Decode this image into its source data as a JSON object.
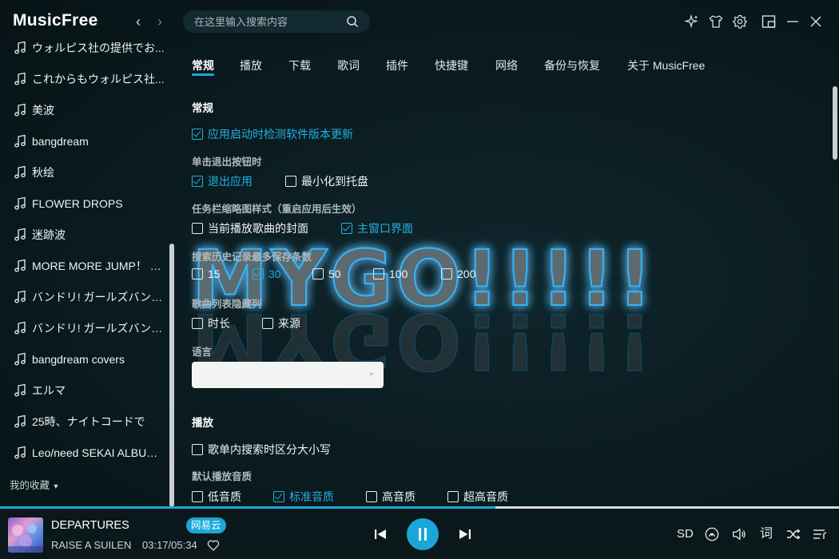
{
  "app": {
    "title": "MusicFree"
  },
  "nav": {
    "back": "‹",
    "forward": "›"
  },
  "search": {
    "placeholder": "在这里输入搜索内容"
  },
  "sidebar": {
    "items": [
      {
        "label": "ウォルピス社の提供でお..."
      },
      {
        "label": "これからもウォルピス社..."
      },
      {
        "label": "美波"
      },
      {
        "label": "bangdream"
      },
      {
        "label": "秋绘"
      },
      {
        "label": "FLOWER DROPS"
      },
      {
        "label": "迷跡波"
      },
      {
        "label": "MORE MORE JUMP！ SE..."
      },
      {
        "label": "バンドリ! ガールズバンド..."
      },
      {
        "label": "バンドリ! ガールズバンド..."
      },
      {
        "label": "bangdream covers"
      },
      {
        "label": "エルマ"
      },
      {
        "label": "25時、ナイトコードで"
      },
      {
        "label": "Leo/need SEKAI ALBUM ..."
      }
    ],
    "favorites_label": "我的收藏"
  },
  "tabs": [
    {
      "label": "常规",
      "active": true
    },
    {
      "label": "播放"
    },
    {
      "label": "下载"
    },
    {
      "label": "歌词"
    },
    {
      "label": "插件"
    },
    {
      "label": "快捷键"
    },
    {
      "label": "网络"
    },
    {
      "label": "备份与恢复"
    },
    {
      "label": "关于 MusicFree"
    }
  ],
  "settings": {
    "general_title": "常规",
    "check_update": {
      "label": "应用启动时检测软件版本更新",
      "checked": true
    },
    "exit_button_title": "单击退出按钮时",
    "exit_app": {
      "label": "退出应用",
      "checked": true
    },
    "minimize_tray": {
      "label": "最小化到托盘",
      "checked": false
    },
    "taskbar_title": "任务栏缩略图样式（重启应用后生效）",
    "thumb_cover": {
      "label": "当前播放歌曲的封面",
      "checked": false
    },
    "thumb_main": {
      "label": "主窗口界面",
      "checked": true
    },
    "history_title": "搜索历史记录最多保存条数",
    "history_options": [
      {
        "label": "15",
        "checked": false
      },
      {
        "label": "30",
        "checked": true
      },
      {
        "label": "50",
        "checked": false
      },
      {
        "label": "100",
        "checked": false
      },
      {
        "label": "200",
        "checked": false
      }
    ],
    "hide_columns_title": "歌曲列表隐藏列",
    "col_duration": {
      "label": "时长",
      "checked": false
    },
    "col_source": {
      "label": "来源",
      "checked": false
    },
    "language_title": "语言",
    "language_value": "",
    "playback_title": "播放",
    "case_sensitive": {
      "label": "歌单内搜索时区分大小写",
      "checked": false
    },
    "quality_title": "默认播放音质",
    "quality_options": [
      {
        "label": "低音质",
        "checked": false
      },
      {
        "label": "标准音质",
        "checked": true
      },
      {
        "label": "高音质",
        "checked": false
      },
      {
        "label": "超高音质",
        "checked": false
      }
    ]
  },
  "art": {
    "text": "MYGO!!!!!"
  },
  "player": {
    "title": "DEPARTURES",
    "artist": "RAISE A SUILEN",
    "time": "03:17/05:34",
    "source_badge": "网易云",
    "progress": 0.59,
    "quality": "SD",
    "lyrics": "词"
  },
  "colors": {
    "accent": "#1aa7d8",
    "background": "#0b1a1f"
  }
}
